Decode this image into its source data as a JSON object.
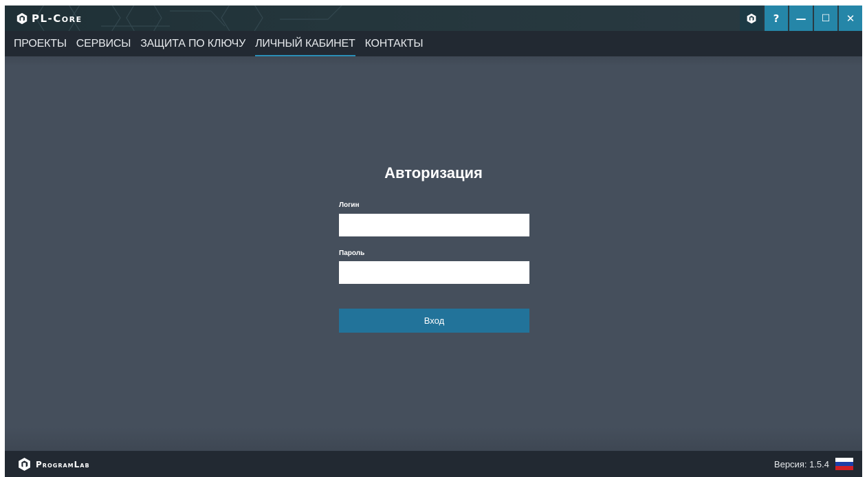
{
  "app": {
    "title": "PL-Core"
  },
  "window_controls": {
    "app_icon": "program-lab-logo-icon",
    "help_label": "?",
    "minimize_label": "—",
    "maximize_label": "☐",
    "close_label": "✕",
    "accent_color": "#2586a8"
  },
  "nav": {
    "items": [
      {
        "label": "ПРОЕКТЫ",
        "active": false
      },
      {
        "label": "СЕРВИСЫ",
        "active": false
      },
      {
        "label": "ЗАЩИТА ПО КЛЮЧУ",
        "active": false
      },
      {
        "label": "ЛИЧНЫЙ КАБИНЕТ",
        "active": true
      },
      {
        "label": "КОНТАКТЫ",
        "active": false
      }
    ],
    "active_underline_color": "#2a8fb8"
  },
  "auth": {
    "title": "Авторизация",
    "login_label": "Логин",
    "login_value": "",
    "password_label": "Пароль",
    "password_value": "",
    "submit_label": "Вход",
    "submit_color": "#22739a"
  },
  "footer": {
    "brand": "ProgramLab",
    "version": "Версия: 1.5.4",
    "language_flag": "russia-flag-icon"
  }
}
